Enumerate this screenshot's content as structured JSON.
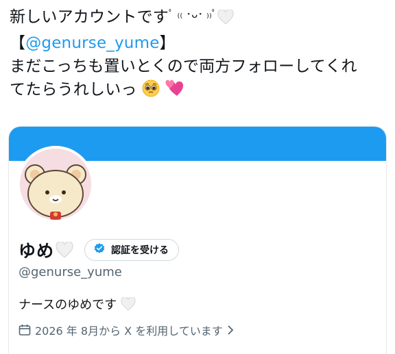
{
  "tweet": {
    "line1": "新しいアカウントです",
    "line1_kaomoji": "ﾟ ₍₍ ･ᴗ･ ₎₎ﾟ",
    "mention_open": "【",
    "mention": "@genurse_yume",
    "mention_close": "】",
    "line3": "まだこっちも置いとくので両方フォローしてくれ",
    "line4": "てたらうれしいっ"
  },
  "profile_card": {
    "banner_color": "#1d9bf0",
    "avatar_icon": "bear-avatar-icon",
    "display_name": "ゆめ",
    "verify_label": "認証を受ける",
    "handle": "@genurse_yume",
    "bio": "ナースのゆめです",
    "joined": "2026 年 8月から X を利用しています"
  }
}
